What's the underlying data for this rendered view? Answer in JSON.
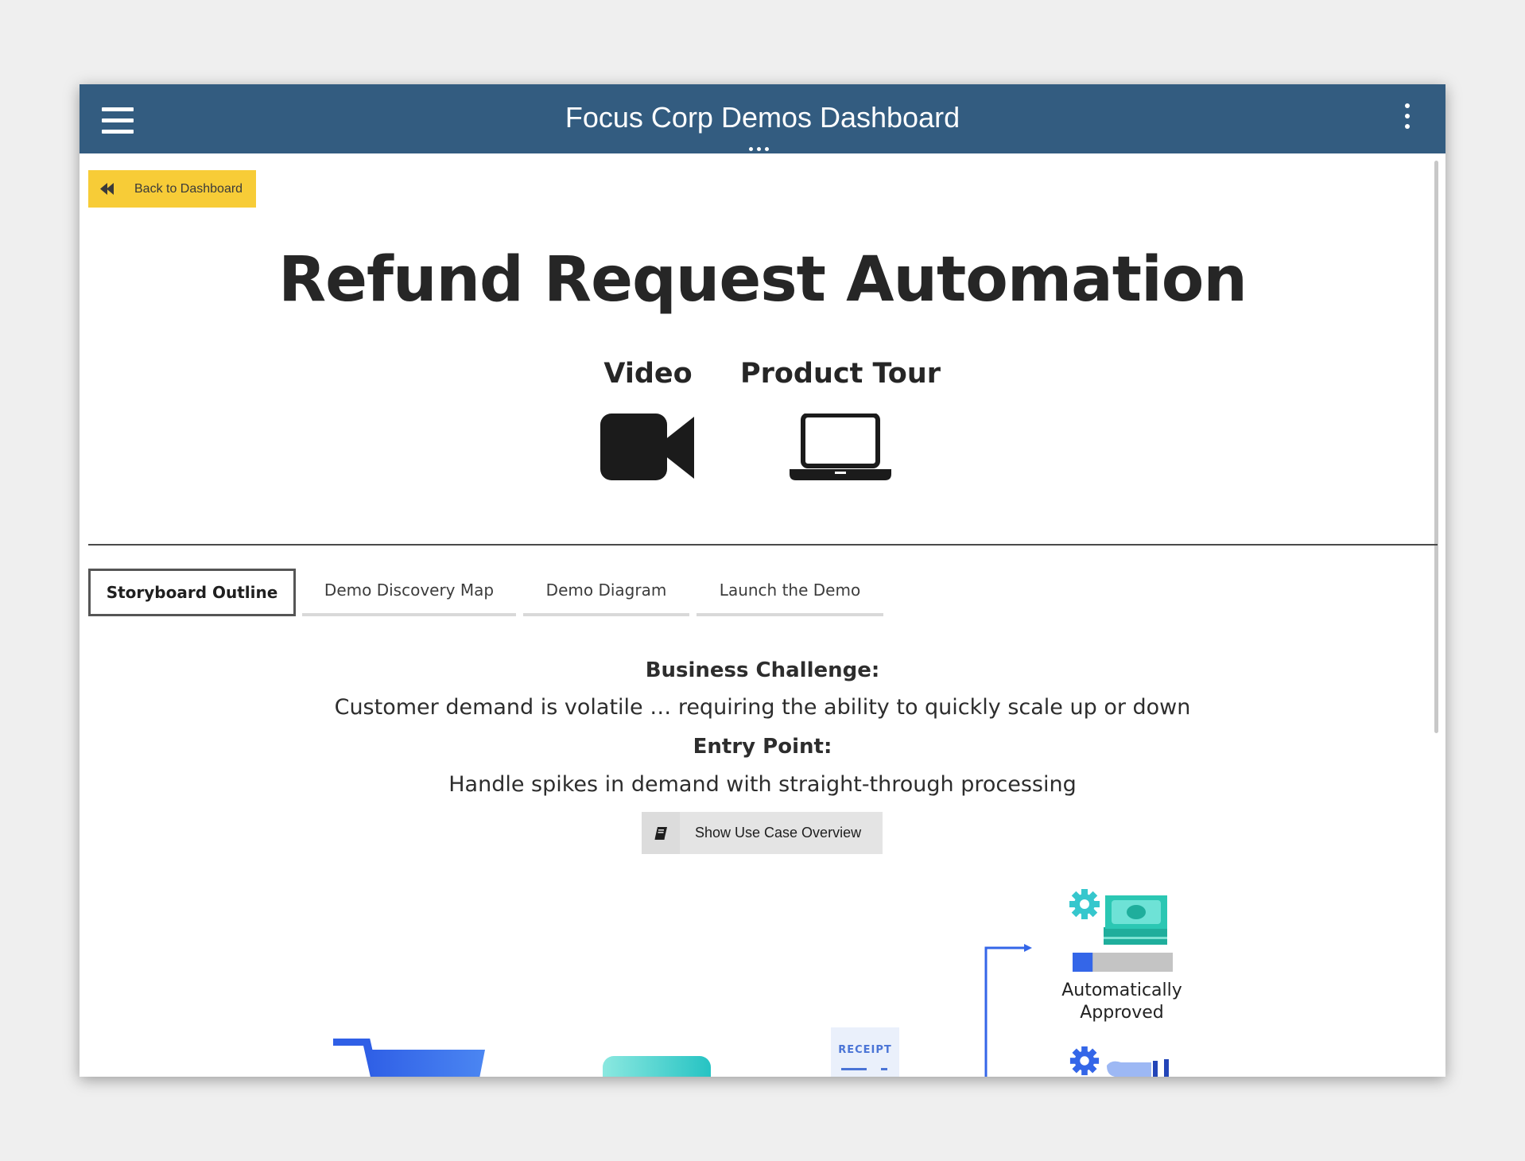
{
  "header": {
    "app_title": "Focus Corp Demos Dashboard"
  },
  "navigation": {
    "back_label": "Back to Dashboard"
  },
  "page": {
    "title": "Refund Request Automation"
  },
  "launch_options": [
    {
      "label": "Video",
      "icon": "video-camera-icon"
    },
    {
      "label": "Product Tour",
      "icon": "laptop-icon"
    }
  ],
  "tabs": [
    {
      "label": "Storyboard Outline",
      "active": true
    },
    {
      "label": "Demo Discovery Map",
      "active": false
    },
    {
      "label": "Demo Diagram",
      "active": false
    },
    {
      "label": "Launch the Demo",
      "active": false
    }
  ],
  "storyboard": {
    "business_challenge_heading": "Business Challenge:",
    "business_challenge_text": "Customer demand is volatile … requiring the ability to quickly scale up or down",
    "entry_point_heading": "Entry Point:",
    "entry_point_text": "Handle spikes in demand with straight-through processing",
    "overview_button_label": "Show Use Case Overview"
  },
  "diagram": {
    "receipt_label": "RECEIPT",
    "approved_label_line1": "Automatically",
    "approved_label_line2": "Approved",
    "progress_fraction": 0.2,
    "colors": {
      "accent_blue": "#3466e8",
      "teal": "#26c3c3",
      "money_green": "#2bb7a6",
      "bar_gray": "#c4c4c4"
    }
  },
  "theme": {
    "topbar_color": "#335c80",
    "back_button_color": "#f7cc37"
  }
}
